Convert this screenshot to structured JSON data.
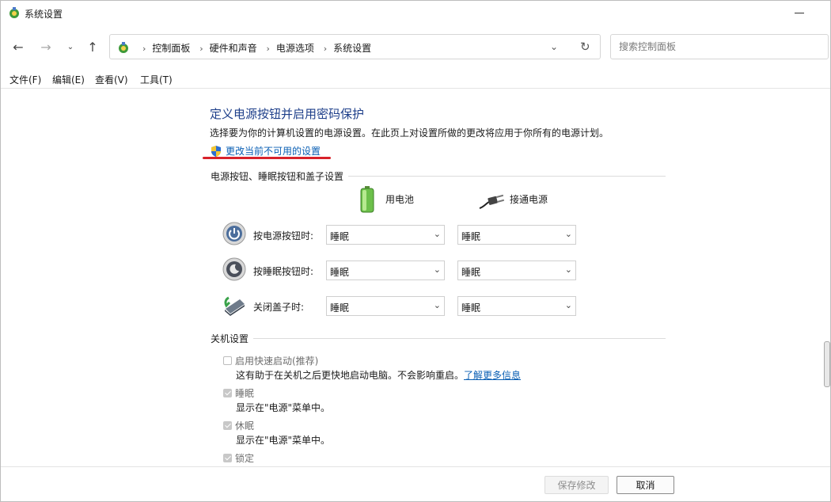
{
  "window": {
    "title": "系统设置"
  },
  "nav": {
    "back_icon": "arrow-left-icon",
    "forward_icon": "arrow-right-icon",
    "recent_icon": "chevron-down-icon",
    "up_icon": "arrow-up-icon",
    "breadcrumbs": [
      "控制面板",
      "硬件和声音",
      "电源选项",
      "系统设置"
    ],
    "search_placeholder": "搜索控制面板"
  },
  "menu": [
    "文件(F)",
    "编辑(E)",
    "查看(V)",
    "工具(T)"
  ],
  "main": {
    "title": "定义电源按钮并启用密码保护",
    "description": "选择要为你的计算机设置的电源设置。在此页上对设置所做的更改将应用于你所有的电源计划。",
    "change_link": "更改当前不可用的设置",
    "group1_header": "电源按钮、睡眠按钮和盖子设置",
    "col_battery": "用电池",
    "col_plugged": "接通电源",
    "rows": [
      {
        "label": "按电源按钮时:",
        "battery": "睡眠",
        "plugged": "睡眠"
      },
      {
        "label": "按睡眠按钮时:",
        "battery": "睡眠",
        "plugged": "睡眠"
      },
      {
        "label": "关闭盖子时:",
        "battery": "睡眠",
        "plugged": "睡眠"
      }
    ],
    "group2_header": "关机设置",
    "shutdown": {
      "fast_startup": {
        "label": "启用快速启动(推荐)",
        "checked": false,
        "desc": "这有助于在关机之后更快地启动电脑。不会影响重启。",
        "learn_more": "了解更多信息"
      },
      "sleep": {
        "label": "睡眠",
        "checked": true,
        "desc": "显示在\"电源\"菜单中。"
      },
      "hibernate": {
        "label": "休眠",
        "checked": true,
        "desc": "显示在\"电源\"菜单中。"
      },
      "lock": {
        "label": "锁定",
        "checked": true
      }
    }
  },
  "footer": {
    "save": "保存修改",
    "cancel": "取消"
  },
  "colors": {
    "title_blue": "#1e3f8a",
    "link_blue": "#0a5fb4",
    "highlight_red": "#d8222a"
  }
}
